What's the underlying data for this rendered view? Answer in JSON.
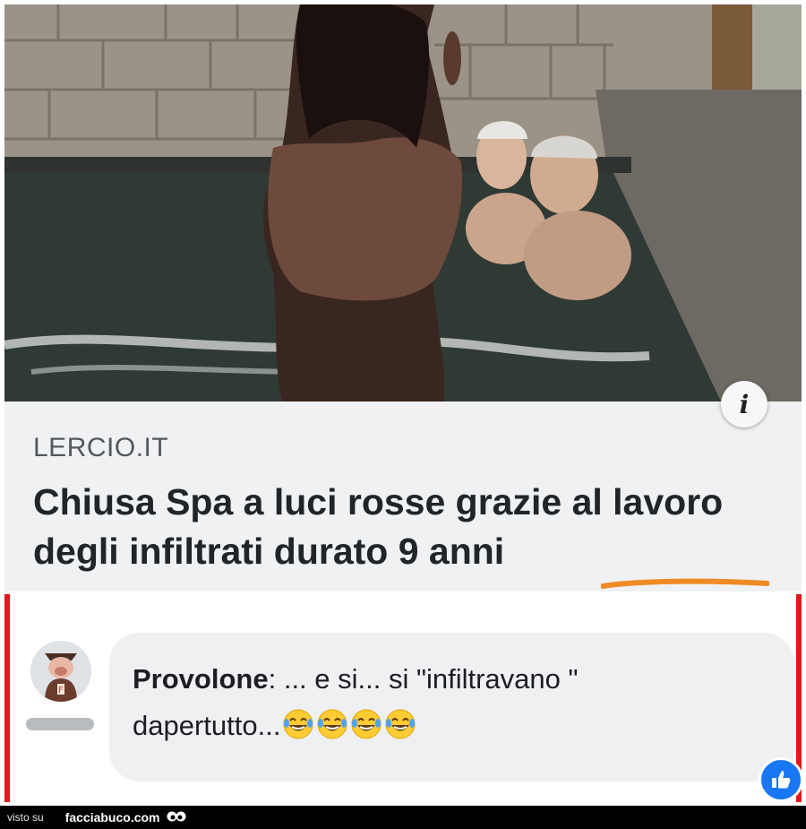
{
  "card": {
    "source": "LERCIO.IT",
    "headline": "Chiusa Spa a luci rosse grazie al lavoro degli infiltrati durato 9 anni",
    "info_icon": "info-icon",
    "info_glyph": "i"
  },
  "comment": {
    "author": "Provolone",
    "separator": ": ",
    "text": "... e si... si \"infiltravano \" dapertutto...",
    "emoji_count": 4,
    "emoji_icon": "laughing-tears-emoji",
    "reaction_icon": "thumbs-up-icon"
  },
  "footer": {
    "prefix": "visto su",
    "site": "facciabuco.com"
  },
  "colors": {
    "highlight_red": "#e1181b",
    "underline_orange": "#f08a24",
    "like_blue": "#1877f2"
  }
}
